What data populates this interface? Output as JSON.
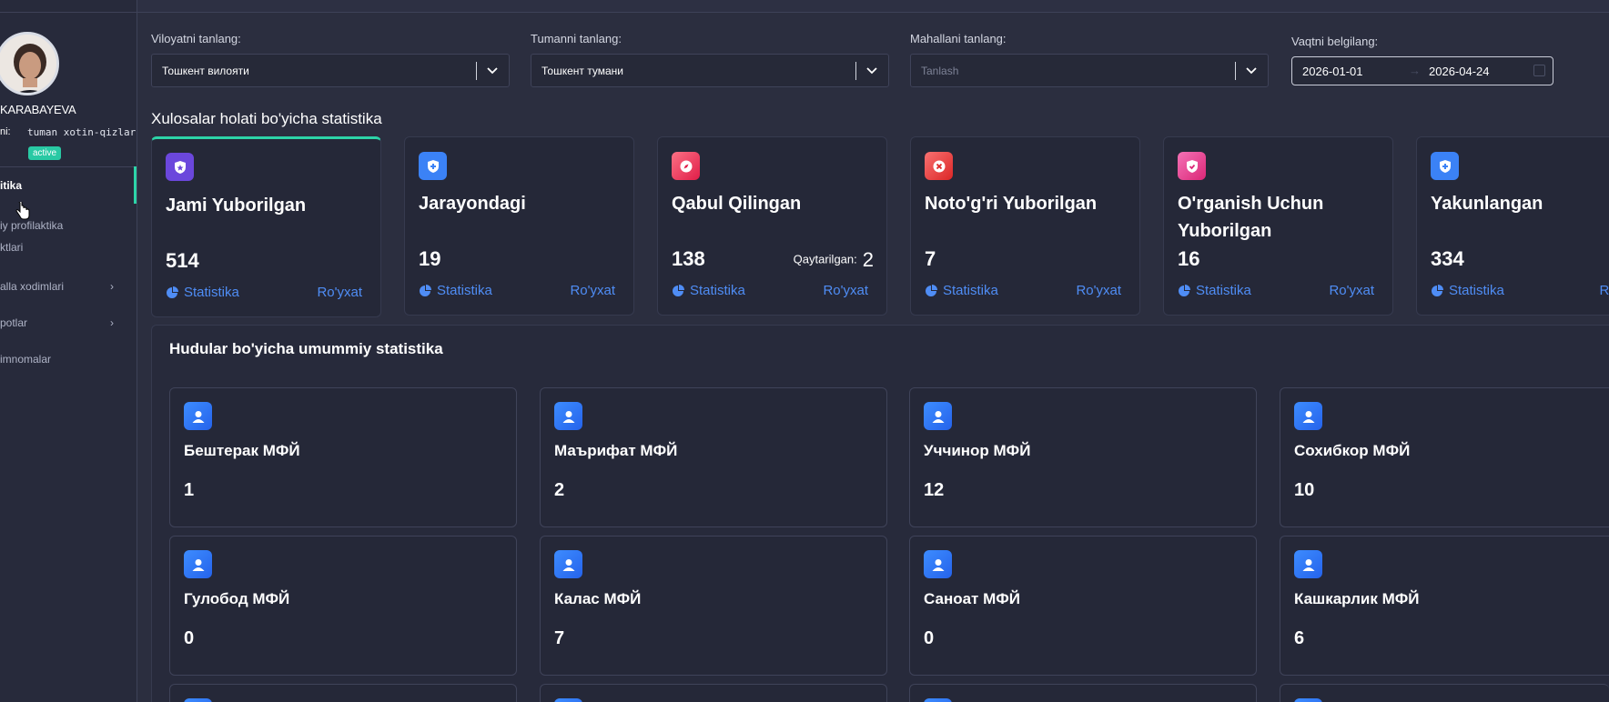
{
  "sidebar": {
    "user_name": "KARABAYEVA",
    "role_label": "ni:",
    "role_value": "tuman xotin-qizlar",
    "status_badge": "active",
    "items": [
      {
        "label": "itika",
        "has_chevron": false,
        "active": true
      },
      {
        "label": "iy profilaktika",
        "has_chevron": false,
        "active": false
      },
      {
        "label": "ktlari",
        "has_chevron": false,
        "active": false
      },
      {
        "label": "alla xodimlari",
        "has_chevron": true,
        "active": false
      },
      {
        "label": "potlar",
        "has_chevron": true,
        "active": false
      },
      {
        "label": "imnomalar",
        "has_chevron": false,
        "active": false
      }
    ]
  },
  "filters": {
    "region_label": "Viloyatni tanlang:",
    "region_value": "Тошкент вилояти",
    "district_label": "Tumanni tanlang:",
    "district_value": "Тошкент тумани",
    "mahalla_label": "Mahallani tanlang:",
    "mahalla_placeholder": "Tanlash",
    "date_label": "Vaqtni belgilang:",
    "date_from": "2026-01-01",
    "date_arrow": "→",
    "date_to": "2026-04-24"
  },
  "status_section": {
    "title": "Xulosalar holati bo'yicha statistika",
    "stat_label": "Statistika",
    "list_label": "Ro'yxat",
    "returned_label": "Qaytarilgan:",
    "cards": [
      {
        "title": "Jami Yuborilgan",
        "value": "514",
        "icon": "star-shield-icon",
        "color": "#6b47dc"
      },
      {
        "title": "Jarayondagi",
        "value": "19",
        "icon": "plus-shield-icon",
        "color": "#3b82f6"
      },
      {
        "title": "Qabul Qilingan",
        "value": "138",
        "returned": "2",
        "icon": "compass-icon",
        "color": "#f43f5e"
      },
      {
        "title": "Noto'g'ri Yuborilgan",
        "value": "7",
        "icon": "close-circle-icon",
        "color": "#ef4444"
      },
      {
        "title": "O'rganish Uchun Yuborilgan",
        "value": "16",
        "icon": "check-shield-icon",
        "color": "#ec4899"
      },
      {
        "title": "Yakunlangan",
        "value": "334",
        "icon": "plus-shield-icon",
        "color": "#3b82f6"
      }
    ]
  },
  "regions": {
    "title": "Hudular bo'yicha umummiy statistika",
    "items": [
      {
        "name": "Бештерак МФЙ",
        "value": "1"
      },
      {
        "name": "Маърифат МФЙ",
        "value": "2"
      },
      {
        "name": "Уччинор МФЙ",
        "value": "12"
      },
      {
        "name": "Сохибкор МФЙ",
        "value": "10"
      },
      {
        "name": "Гулобод МФЙ",
        "value": "0"
      },
      {
        "name": "Калас МФЙ",
        "value": "7"
      },
      {
        "name": "Саноат МФЙ",
        "value": "0"
      },
      {
        "name": "Кашкарлик МФЙ",
        "value": "6"
      }
    ]
  }
}
